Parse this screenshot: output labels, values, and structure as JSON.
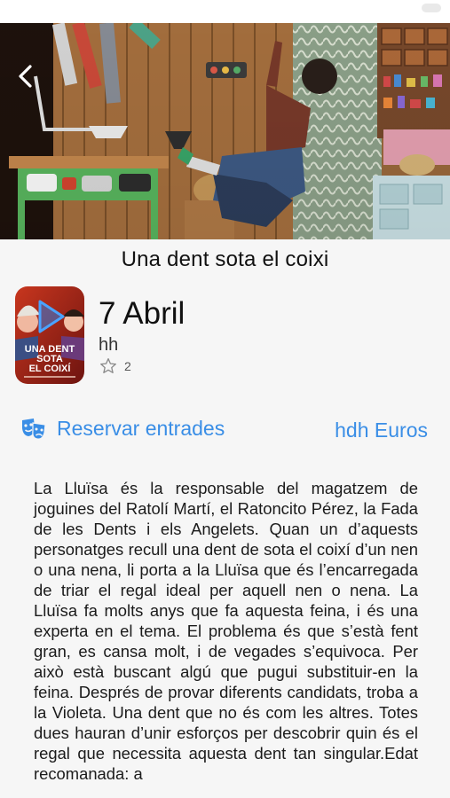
{
  "event": {
    "title": "Una dent sota el coixi",
    "date": "7 Abril",
    "time": "hh",
    "rating_count": "2",
    "price": "hdh Euros"
  },
  "poster": {
    "title_lines": [
      "UNA DENT",
      "SOTA",
      "EL COIXÍ"
    ]
  },
  "actions": {
    "reserve_label": "Reservar entrades"
  },
  "description": "La Lluïsa és la responsable del magatzem de joguines del Ratolí Martí, el Ratoncito Pérez, la Fada de les Dents i els Angelets. Quan un d’aquests personatges recull una dent de sota el coixí d’un nen o una nena, li porta a la Lluïsa que és l’encarregada de triar el regal ideal per aquell nen o nena. La Lluïsa fa molts anys que fa aquesta feina, i és una experta en el tema. El problema és que s’està fent gran, es cansa molt, i de vegades s’equivoca. Per això està buscant algú que pugui substituir-en la feina. Després de provar diferents candidats, troba a la Violeta.  Una dent que no és com les altres. Totes dues hauran d’unir esforços per descobrir quin és el regal que necessita aquesta dent tan singular.Edat recomanada: a",
  "colors": {
    "accent": "#3a8ee6",
    "background": "#f6f6f6"
  },
  "icons": {
    "back": "chevron-left-icon",
    "rating": "star-outline-icon",
    "reserve": "theater-masks-icon",
    "play": "play-icon"
  }
}
